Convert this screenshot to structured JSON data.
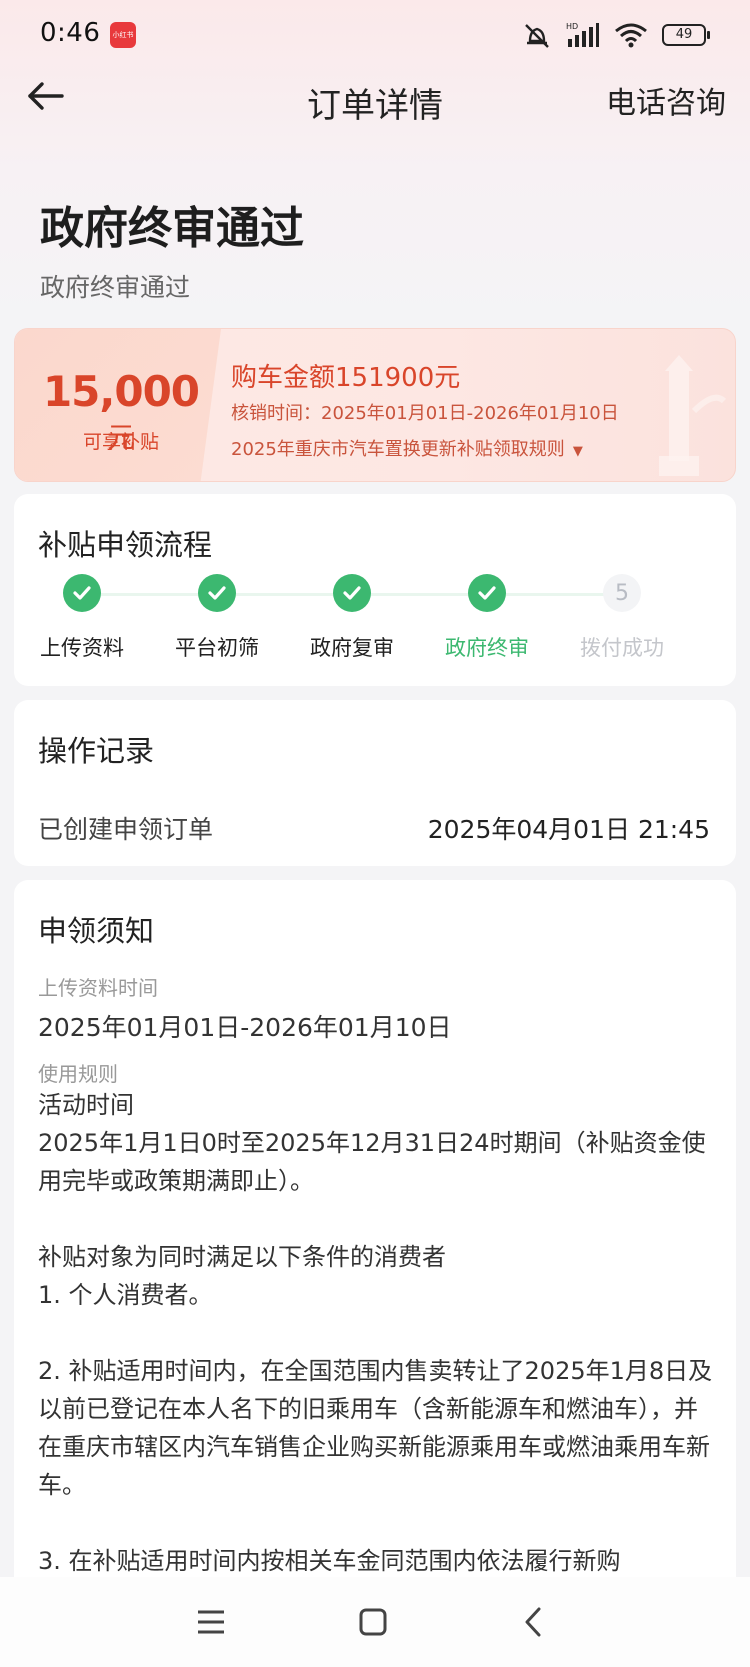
{
  "status_bar": {
    "time": "0:46",
    "app_badge": "小红书",
    "battery": "49"
  },
  "header": {
    "title": "订单详情",
    "phone_consult": "电话咨询"
  },
  "order_status": {
    "title": "政府终审通过",
    "subtitle": "政府终审通过"
  },
  "subsidy_card": {
    "amount": "15,000",
    "amount_unit": "元",
    "amount_label": "可享补贴",
    "purchase_amount": "购车金额151900元",
    "verify_time": "核销时间：2025年01月01日-2026年01月10日",
    "rules_link": "2025年重庆市汽车置换更新补贴领取规则",
    "colors": {
      "accent": "#d9452a",
      "background": "#fde7e3"
    }
  },
  "process": {
    "title": "补贴申领流程",
    "steps": [
      {
        "label": "上传资料",
        "state": "done"
      },
      {
        "label": "平台初筛",
        "state": "done"
      },
      {
        "label": "政府复审",
        "state": "done"
      },
      {
        "label": "政府终审",
        "state": "current"
      },
      {
        "label": "拨付成功",
        "state": "pending",
        "number": "5"
      }
    ],
    "colors": {
      "done": "#3cb870",
      "pending": "#c4c6cb"
    }
  },
  "records": {
    "title": "操作记录",
    "items": [
      {
        "label": "已创建申领订单",
        "time": "2025年04月01日 21:45"
      }
    ]
  },
  "notice": {
    "title": "申领须知",
    "upload_time_label": "上传资料时间",
    "upload_time_value": "2025年01月01日-2026年01月10日",
    "usage_rules_label": "使用规则",
    "rules_lines": [
      "活动时间",
      "2025年1月1日0时至2025年12月31日24时期间（补贴资金使用完毕或政策期满即止）。",
      "",
      "补贴对象为同时满足以下条件的消费者",
      "1. 个人消费者。",
      "",
      "2. 补贴适用时间内，在全国范围内售卖转让了2025年1月8日及以前已登记在本人名下的旧乘用车（含新能源车和燃油车），并在重庆市辖区内汽车销售企业购买新能源乘用车或燃油乘用车新车。",
      "",
      "3. 在补贴适用时间内按相关车金同范围内依法履行新购"
    ]
  },
  "nav_bar": {
    "icons": [
      "menu-icon",
      "home-icon",
      "back-icon"
    ]
  }
}
